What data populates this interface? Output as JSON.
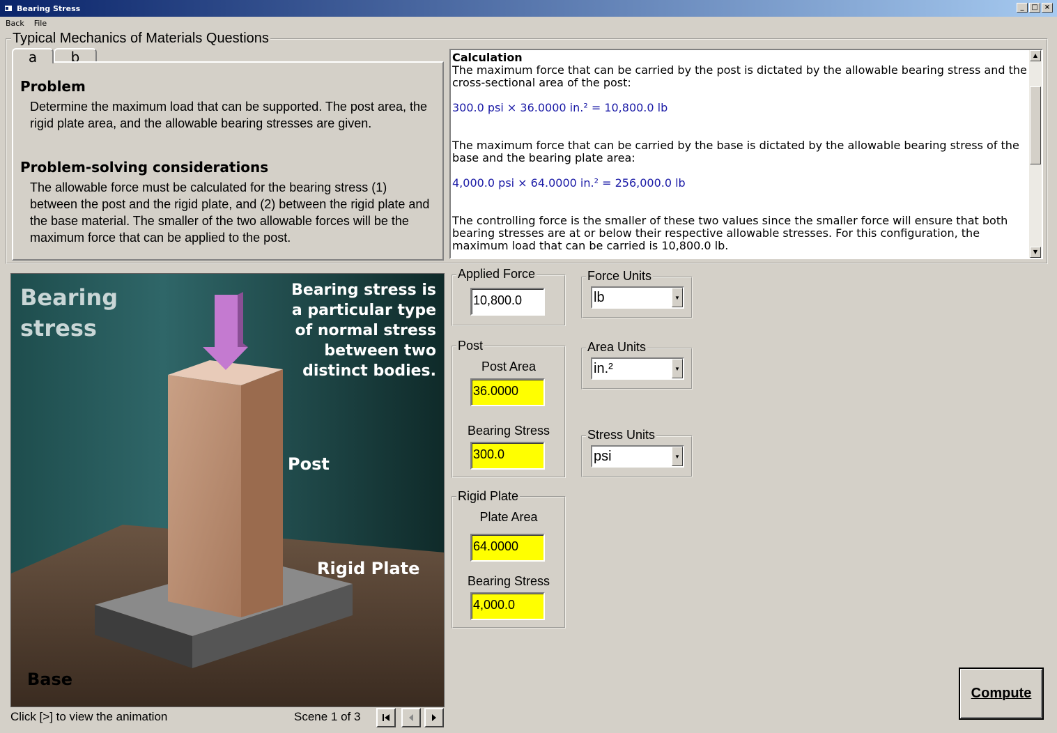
{
  "window": {
    "title": "Bearing Stress",
    "controls": [
      "_",
      "□",
      "×"
    ]
  },
  "menu": {
    "items": [
      "Back",
      "File"
    ]
  },
  "questions_group": {
    "title": "Typical Mechanics of Materials Questions"
  },
  "tabs": [
    {
      "label": "a"
    },
    {
      "label": "b"
    }
  ],
  "problem": {
    "heading": "Problem",
    "text": "Determine the maximum load that can be supported.  The post area, the rigid plate area, and the allowable bearing stresses are given.",
    "considerations_heading": "Problem-solving considerations",
    "considerations_text": "The allowable force must be calculated for the bearing stress (1) between the post and the rigid plate, and (2) between the rigid plate and the base material.  The smaller of the two allowable forces will be the maximum force that can be applied to the post."
  },
  "calculation": {
    "heading": "Calculation",
    "p1": "The maximum force that can be carried by the post is dictated by the allowable bearing stress and the cross-sectional area of the post:",
    "eq1": "300.0 psi × 36.0000 in.² = 10,800.0 lb",
    "p2": "The maximum force that can be carried by the base is dictated by the allowable bearing stress of the base and the bearing plate area:",
    "eq2": "4,000.0 psi × 64.0000 in.² = 256,000.0 lb",
    "p3": "The controlling force is the smaller of these two values since the smaller force will ensure that both bearing stresses are at or below their respective allowable stresses.  For this configuration, the maximum load that can be carried is 10,800.0 lb."
  },
  "animation": {
    "title": "Bearing stress",
    "caption": "Bearing stress is a particular type of normal stress between two distinct bodies.",
    "label_post": "Post",
    "label_plate": "Rigid Plate",
    "label_base": "Base",
    "hint": "Click [>] to view the animation",
    "scene": "Scene 1 of 3"
  },
  "applied_force": {
    "title": "Applied Force",
    "value": "10,800.0"
  },
  "post": {
    "title": "Post",
    "area_label": "Post Area",
    "area_value": "36.0000",
    "stress_label": "Bearing Stress",
    "stress_value": "300.0"
  },
  "rigid_plate": {
    "title": "Rigid Plate",
    "area_label": "Plate Area",
    "area_value": "64.0000",
    "stress_label": "Bearing Stress",
    "stress_value": "4,000.0"
  },
  "units": {
    "force_title": "Force Units",
    "force_value": "lb",
    "area_title": "Area Units",
    "area_value": "in.²",
    "stress_title": "Stress Units",
    "stress_value": "psi"
  },
  "compute": {
    "label": "Compute"
  },
  "colors": {
    "highlight_input": "#ffff00",
    "equation": "#1a1aa6",
    "titlebar": "#0a246a"
  }
}
